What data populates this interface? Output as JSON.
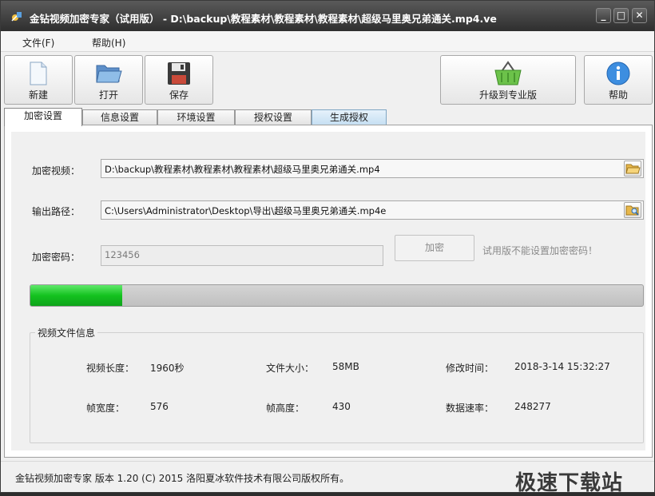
{
  "titlebar": {
    "title": "金钻视频加密专家（试用版） - D:\\backup\\教程素材\\教程素材\\教程素材\\超级马里奥兄弟通关.mp4.ve",
    "min": "_",
    "max": "□",
    "close": "✕"
  },
  "menu": {
    "file": "文件(F)",
    "help": "帮助(H)"
  },
  "toolbar": {
    "new": "新建",
    "open": "打开",
    "save": "保存",
    "upgrade": "升级到专业版",
    "help": "帮助"
  },
  "tabs": [
    {
      "label": "加密设置"
    },
    {
      "label": "信息设置"
    },
    {
      "label": "环境设置"
    },
    {
      "label": "授权设置"
    },
    {
      "label": "生成授权"
    }
  ],
  "form": {
    "video_label": "加密视频：",
    "video_value": "D:\\backup\\教程素材\\教程素材\\教程素材\\超级马里奥兄弟通关.mp4",
    "output_label": "输出路径：",
    "output_value": "C:\\Users\\Administrator\\Desktop\\导出\\超级马里奥兄弟通关.mp4e",
    "password_label": "加密密码：",
    "password_value": "123456",
    "encrypt_button": "加密",
    "trial_note": "试用版不能设置加密密码！"
  },
  "progress": {
    "fraction": 0.15
  },
  "info": {
    "title": "视频文件信息",
    "duration_label": "视频长度：",
    "duration_value": "1960秒",
    "size_label": "文件大小：",
    "size_value": "58MB",
    "modified_label": "修改时间：",
    "modified_value": "2018-3-14 15:32:27",
    "width_label": "帧宽度：",
    "width_value": "576",
    "height_label": "帧高度：",
    "height_value": "430",
    "rate_label": "数据速率：",
    "rate_value": "248277"
  },
  "status": {
    "text": "金钻视频加密专家 版本 1.20 (C) 2015 洛阳夏冰软件技术有限公司版权所有。",
    "watermark": "极速下载站"
  }
}
